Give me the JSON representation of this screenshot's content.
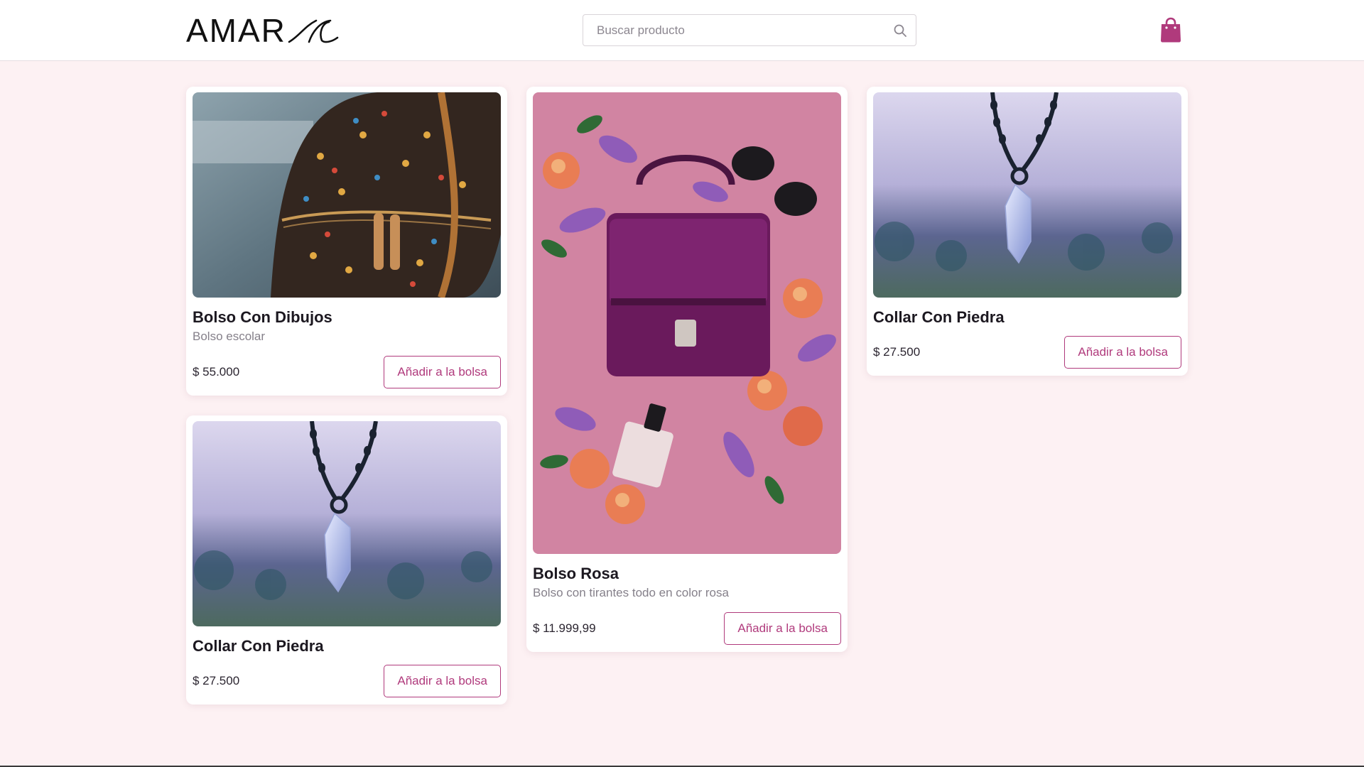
{
  "header": {
    "logo_text": "AMAR",
    "search_placeholder": "Buscar producto",
    "bag_icon": "shopping-bag-icon",
    "brand_color": "#b03a7c"
  },
  "products": [
    {
      "title": "Bolso Con Dibujos",
      "description": "Bolso escolar",
      "price": "$ 55.000",
      "button": "Añadir a la bolsa",
      "image": "patterned backpack"
    },
    {
      "title": "Collar Con Piedra",
      "description": "",
      "price": "$ 27.500",
      "button": "Añadir a la bolsa",
      "image": "crystal pendant on chain"
    },
    {
      "title": "Bolso Rosa",
      "description": "Bolso con tirantes todo en color rosa",
      "price": "$ 11.999,99",
      "button": "Añadir a la bolsa",
      "image": "purple handbag with peaches and flowers"
    },
    {
      "title": "Collar Con Piedra",
      "description": "",
      "price": "$ 27.500",
      "button": "Añadir a la bolsa",
      "image": "crystal pendant on chain"
    }
  ]
}
